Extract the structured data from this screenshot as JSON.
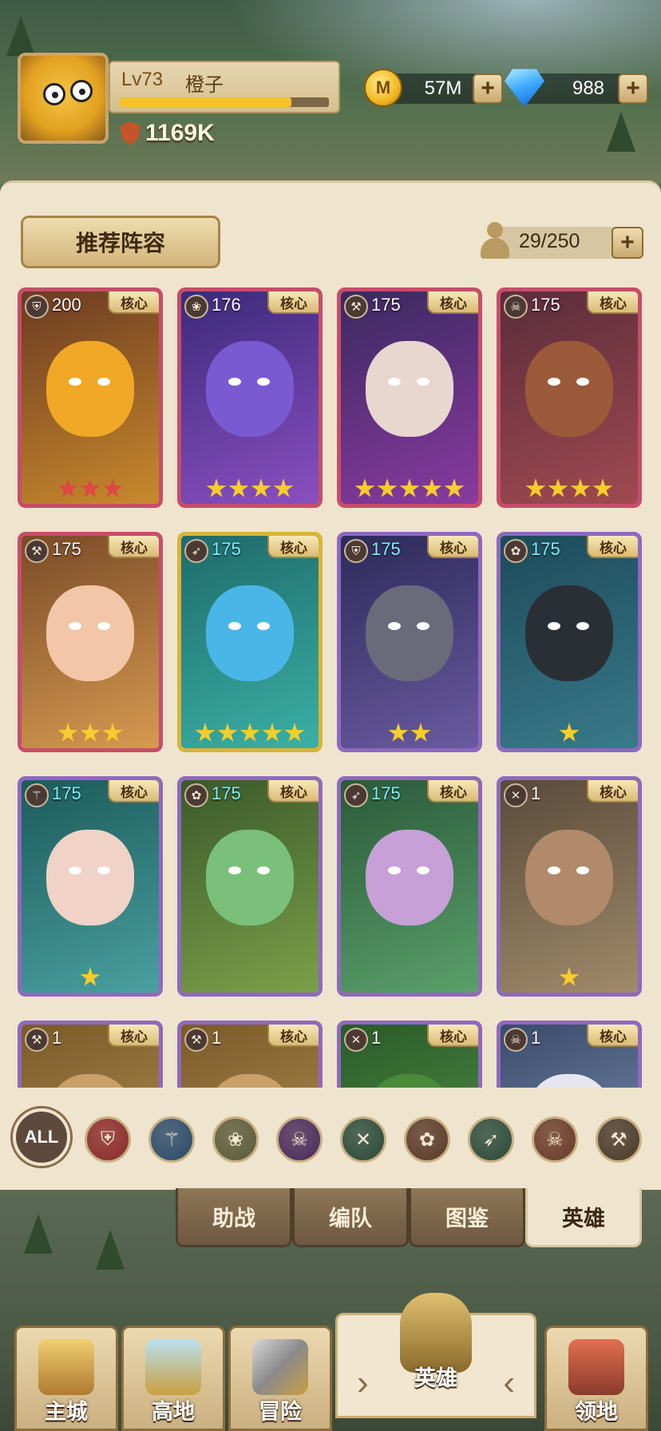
{
  "player": {
    "level": "Lv73",
    "name": "橙子",
    "xp_fraction": 0.82,
    "power": "1169K"
  },
  "resources": {
    "gold": "57M",
    "gold_icon_glyph": "M",
    "gems": "988",
    "plus": "+"
  },
  "panel": {
    "recommend_label": "推荐阵容",
    "capacity": "29/250",
    "capacity_plus": "+"
  },
  "core_label": "核心",
  "heroes": [
    {
      "level": "200",
      "cls": "shield-icon",
      "glyph": "⛨",
      "stars": 3,
      "star_color": "red",
      "frame": "pink",
      "cyan": false,
      "art": [
        "#6b3a22",
        "#c98a2c"
      ],
      "face": "#f0a826"
    },
    {
      "level": "176",
      "cls": "laurel-icon",
      "glyph": "❀",
      "stars": 4,
      "star_color": "gold",
      "frame": "pink",
      "cyan": false,
      "art": [
        "#3b2a7a",
        "#8a4fc0"
      ],
      "face": "#7a5ad0"
    },
    {
      "level": "175",
      "cls": "hammer-icon",
      "glyph": "⚒",
      "stars": 5,
      "star_color": "gold",
      "frame": "pink",
      "cyan": false,
      "art": [
        "#3a2960",
        "#8a3aa0"
      ],
      "face": "#e8d6cf"
    },
    {
      "level": "175",
      "cls": "skull-icon",
      "glyph": "☠",
      "stars": 4,
      "star_color": "gold",
      "frame": "pink",
      "cyan": false,
      "art": [
        "#5a2c3a",
        "#a04a50"
      ],
      "face": "#9a5a3a"
    },
    {
      "level": "175",
      "cls": "hammer-icon",
      "glyph": "⚒",
      "stars": 3,
      "star_color": "gold",
      "frame": "pink",
      "cyan": false,
      "art": [
        "#7a4a28",
        "#d69a50"
      ],
      "face": "#f2c6a6"
    },
    {
      "level": "175",
      "cls": "bow-icon",
      "glyph": "➶",
      "stars": 5,
      "star_color": "gold",
      "frame": "gold",
      "cyan": true,
      "art": [
        "#1e6a6a",
        "#3bb0a6"
      ],
      "face": "#4ab6e8"
    },
    {
      "level": "175",
      "cls": "shield-icon",
      "glyph": "⛨",
      "stars": 2,
      "star_color": "gold",
      "frame": "purple",
      "cyan": true,
      "art": [
        "#2c2a5a",
        "#6a5aa0"
      ],
      "face": "#6a6a7a"
    },
    {
      "level": "175",
      "cls": "paw-icon",
      "glyph": "✿",
      "stars": 1,
      "star_color": "gold",
      "frame": "purple",
      "cyan": true,
      "art": [
        "#1c4a5a",
        "#3a7a8a"
      ],
      "face": "#2a2f36"
    },
    {
      "level": "175",
      "cls": "staff-icon",
      "glyph": "⚚",
      "stars": 1,
      "star_color": "gold",
      "frame": "purple",
      "cyan": true,
      "art": [
        "#1c5a5a",
        "#4aa0a0"
      ],
      "face": "#f0d2c6"
    },
    {
      "level": "175",
      "cls": "paw-icon",
      "glyph": "✿",
      "stars": 0,
      "star_color": "gold",
      "frame": "purple",
      "cyan": true,
      "art": [
        "#3a5a2a",
        "#7aa04a"
      ],
      "face": "#7ac07a"
    },
    {
      "level": "175",
      "cls": "bow-icon",
      "glyph": "➶",
      "stars": 0,
      "star_color": "gold",
      "frame": "purple",
      "cyan": true,
      "art": [
        "#2a5a3a",
        "#5aa06a"
      ],
      "face": "#c6a0d6"
    },
    {
      "level": "1",
      "cls": "daggers-icon",
      "glyph": "✕",
      "stars": 1,
      "star_color": "gold",
      "frame": "purple",
      "cyan": false,
      "art": [
        "#5a4a3a",
        "#a08a6a"
      ],
      "face": "#b08a6a"
    },
    {
      "level": "1",
      "cls": "hammer-icon",
      "glyph": "⚒",
      "stars": 0,
      "star_color": "gold",
      "frame": "purple",
      "cyan": false,
      "art": [
        "#7a5a2a",
        "#c09a5a"
      ],
      "face": "#c9a06a"
    },
    {
      "level": "1",
      "cls": "hammer-icon",
      "glyph": "⚒",
      "stars": 0,
      "star_color": "gold",
      "frame": "purple",
      "cyan": false,
      "art": [
        "#7a5a2a",
        "#c09a5a"
      ],
      "face": "#c9a06a"
    },
    {
      "level": "1",
      "cls": "daggers-icon",
      "glyph": "✕",
      "stars": 0,
      "star_color": "gold",
      "frame": "purple",
      "cyan": false,
      "art": [
        "#2a5a2a",
        "#5aa04a"
      ],
      "face": "#4a8a3a"
    },
    {
      "level": "1",
      "cls": "skull-icon",
      "glyph": "☠",
      "stars": 0,
      "star_color": "gold",
      "frame": "purple",
      "cyan": false,
      "art": [
        "#3a4a6a",
        "#8aa0c0"
      ],
      "face": "#e6e6ef"
    }
  ],
  "filters": {
    "all_label": "ALL",
    "items": [
      {
        "name": "filter-shield-icon",
        "glyph": "⛨",
        "color": "#8a2a2a"
      },
      {
        "name": "filter-staff-icon",
        "glyph": "⚚",
        "color": "#2a4a6a"
      },
      {
        "name": "filter-laurel-icon",
        "glyph": "❀",
        "color": "#5a5a3a"
      },
      {
        "name": "filter-skull-icon",
        "glyph": "☠",
        "color": "#4a2a5a"
      },
      {
        "name": "filter-daggers-icon",
        "glyph": "✕",
        "color": "#2a4a3a"
      },
      {
        "name": "filter-paw-icon",
        "glyph": "✿",
        "color": "#5a3a2a"
      },
      {
        "name": "filter-bow-icon",
        "glyph": "➶",
        "color": "#2a4a3a"
      },
      {
        "name": "filter-bull-skull-icon",
        "glyph": "☠",
        "color": "#6a3a2a"
      },
      {
        "name": "filter-hammer-icon",
        "glyph": "⚒",
        "color": "#4a3a2a"
      }
    ]
  },
  "tabs": [
    "助战",
    "编队",
    "图鉴",
    "英雄"
  ],
  "nav": [
    "主城",
    "高地",
    "冒险",
    "英雄",
    "领地"
  ]
}
